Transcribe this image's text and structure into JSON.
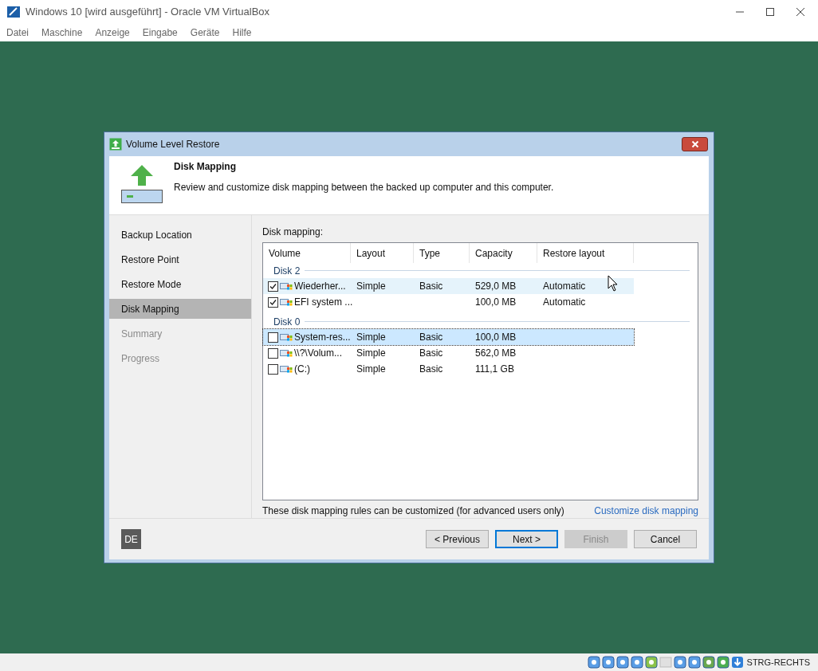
{
  "window": {
    "title": "Windows 10 [wird ausgeführt] - Oracle VM VirtualBox"
  },
  "menu": [
    "Datei",
    "Maschine",
    "Anzeige",
    "Eingabe",
    "Geräte",
    "Hilfe"
  ],
  "dialog": {
    "title": "Volume Level Restore",
    "header": {
      "title": "Disk Mapping",
      "description": "Review and customize disk mapping between the backed up computer and this computer."
    },
    "steps": [
      {
        "label": "Backup Location",
        "selected": false,
        "disabled": false
      },
      {
        "label": "Restore Point",
        "selected": false,
        "disabled": false
      },
      {
        "label": "Restore Mode",
        "selected": false,
        "disabled": false
      },
      {
        "label": "Disk Mapping",
        "selected": true,
        "disabled": false
      },
      {
        "label": "Summary",
        "selected": false,
        "disabled": true
      },
      {
        "label": "Progress",
        "selected": false,
        "disabled": true
      }
    ],
    "table_label": "Disk mapping:",
    "columns": [
      "Volume",
      "Layout",
      "Type",
      "Capacity",
      "Restore layout"
    ],
    "groups": [
      {
        "name": "Disk 2",
        "rows": [
          {
            "volume": "Wiederher...",
            "layout": "Simple",
            "type": "Basic",
            "capacity": "529,0 MB",
            "restore_layout": "Automatic",
            "checked": true,
            "hovered": true,
            "selected": false
          },
          {
            "volume": "EFI system ...",
            "layout": "",
            "type": "",
            "capacity": "100,0 MB",
            "restore_layout": "Automatic",
            "checked": true,
            "hovered": false,
            "selected": false
          }
        ]
      },
      {
        "name": "Disk 0",
        "rows": [
          {
            "volume": "System-res...",
            "layout": "Simple",
            "type": "Basic",
            "capacity": "100,0 MB",
            "restore_layout": "",
            "checked": false,
            "hovered": false,
            "selected": true
          },
          {
            "volume": "\\\\?\\Volum...",
            "layout": "Simple",
            "type": "Basic",
            "capacity": "562,0 MB",
            "restore_layout": "",
            "checked": false,
            "hovered": false,
            "selected": false
          },
          {
            "volume": "(C:)",
            "layout": "Simple",
            "type": "Basic",
            "capacity": "111,1 GB",
            "restore_layout": "",
            "checked": false,
            "hovered": false,
            "selected": false
          }
        ]
      }
    ],
    "note": "These disk mapping rules can be customized (for advanced users only)",
    "customize_link": "Customize disk mapping",
    "language_badge": "DE",
    "buttons": [
      {
        "label": "< Previous",
        "default": false,
        "disabled": false
      },
      {
        "label": "Next >",
        "default": true,
        "disabled": false
      },
      {
        "label": "Finish",
        "default": false,
        "disabled": true
      },
      {
        "label": "Cancel",
        "default": false,
        "disabled": false
      }
    ]
  },
  "status_bar": {
    "host_key": "STRG-RECHTS"
  }
}
